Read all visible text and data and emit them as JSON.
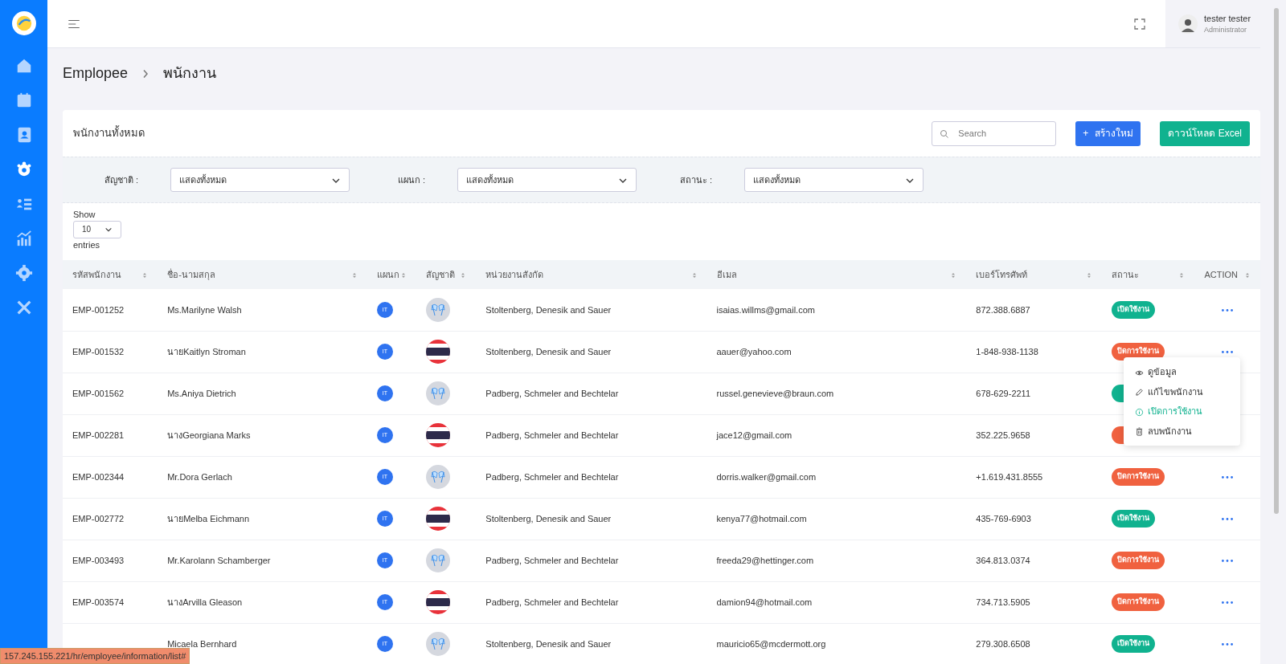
{
  "sidebar": {
    "items": [
      {
        "kind": "home",
        "selected": false
      },
      {
        "kind": "calendar",
        "selected": false
      },
      {
        "kind": "contacts",
        "selected": false
      },
      {
        "kind": "team",
        "selected": true
      },
      {
        "kind": "list",
        "selected": false
      },
      {
        "kind": "chart",
        "selected": false
      },
      {
        "kind": "gear",
        "selected": false
      },
      {
        "kind": "tools",
        "selected": false
      }
    ]
  },
  "user": {
    "name": "tester tester",
    "role": "Administrator"
  },
  "breadcrumb": [
    "Emplopee",
    "พนักงาน"
  ],
  "card": {
    "title": "พนักงานทั้งหมด",
    "search": {
      "placeholder": "Search"
    },
    "create_button": "สร้างใหม่",
    "create_icon": "+",
    "excel_button": "ดาวน์โหลด Excel"
  },
  "filters": [
    {
      "label": "สัญชาติ :",
      "value": "แสดงทั้งหมด"
    },
    {
      "label": "แผนก :",
      "value": "แสดงทั้งหมด"
    },
    {
      "label": "สถานะ :",
      "value": "แสดงทั้งหมด"
    }
  ],
  "page_size": {
    "before": "Show",
    "value": "10",
    "after": "entries"
  },
  "table": {
    "columns": [
      "รหัสพนักงาน",
      "ชื่อ-นามสกุล",
      "แผนก",
      "สัญชาติ",
      "หน่วยงานสังกัด",
      "อีเมล",
      "เบอร์โทรศัพท์",
      "สถานะ",
      "ACTION"
    ],
    "rows": [
      {
        "code": "EMP-001252",
        "name": "Ms.Marilyne Walsh",
        "dept": "IT",
        "nationality": {
          "kind": "generic"
        },
        "unit": "Stoltenberg, Denesik and Sauer",
        "email": "isaias.willms@gmail.com",
        "phone": "872.388.6887",
        "status": {
          "kind": "active",
          "label": "เปิดใช้งาน"
        }
      },
      {
        "code": "EMP-001532",
        "name": "นายKaitlyn Stroman",
        "dept": "IT",
        "nationality": {
          "kind": "thai"
        },
        "unit": "Stoltenberg, Denesik and Sauer",
        "email": "aauer@yahoo.com",
        "phone": "1-848-938-1138",
        "status": {
          "kind": "inactive",
          "label": "ปิดการใช้งาน"
        }
      },
      {
        "code": "EMP-001562",
        "name": "Ms.Aniya Dietrich",
        "dept": "IT",
        "nationality": {
          "kind": "generic"
        },
        "unit": "Padberg, Schmeler and Bechtelar",
        "email": "russel.genevieve@braun.com",
        "phone": "678-629-2211",
        "status": {
          "kind": "active"
        }
      },
      {
        "code": "EMP-002281",
        "name": "นางGeorgiana Marks",
        "dept": "IT",
        "nationality": {
          "kind": "thai"
        },
        "unit": "Padberg, Schmeler and Bechtelar",
        "email": "jace12@gmail.com",
        "phone": "352.225.9658",
        "status": {
          "kind": "inactive"
        }
      },
      {
        "code": "EMP-002344",
        "name": "Mr.Dora Gerlach",
        "dept": "IT",
        "nationality": {
          "kind": "generic"
        },
        "unit": "Padberg, Schmeler and Bechtelar",
        "email": "dorris.walker@gmail.com",
        "phone": "+1.619.431.8555",
        "status": {
          "kind": "inactive",
          "label": "ปิดการใช้งาน"
        }
      },
      {
        "code": "EMP-002772",
        "name": "นายMelba Eichmann",
        "dept": "IT",
        "nationality": {
          "kind": "thai"
        },
        "unit": "Stoltenberg, Denesik and Sauer",
        "email": "kenya77@hotmail.com",
        "phone": "435-769-6903",
        "status": {
          "kind": "active",
          "label": "เปิดใช้งาน"
        }
      },
      {
        "code": "EMP-003493",
        "name": "Mr.Karolann Schamberger",
        "dept": "IT",
        "nationality": {
          "kind": "generic"
        },
        "unit": "Padberg, Schmeler and Bechtelar",
        "email": "freeda29@hettinger.com",
        "phone": "364.813.0374",
        "status": {
          "kind": "inactive",
          "label": "ปิดการใช้งาน"
        }
      },
      {
        "code": "EMP-003574",
        "name": "นางArvilla Gleason",
        "dept": "IT",
        "nationality": {
          "kind": "thai"
        },
        "unit": "Padberg, Schmeler and Bechtelar",
        "email": "damion94@hotmail.com",
        "phone": "734.713.5905",
        "status": {
          "kind": "inactive",
          "label": "ปิดการใช้งาน"
        }
      },
      {
        "name": "Micaela Bernhard",
        "dept": "IT",
        "nationality": {
          "kind": "generic"
        },
        "unit": "Stoltenberg, Denesik and Sauer",
        "email": "mauricio65@mcdermott.org",
        "phone": "279.308.6508",
        "status": {
          "kind": "active",
          "label": "เปิดใช้งาน"
        }
      }
    ]
  },
  "action_menu": {
    "items": [
      {
        "kind": "view",
        "label": "ดูข้อมูล",
        "highlighted": false
      },
      {
        "kind": "edit",
        "label": "แก้ไขพนักงาน",
        "highlighted": false
      },
      {
        "kind": "enable",
        "label": "เปิดการใช้งาน",
        "highlighted": true
      },
      {
        "kind": "delete",
        "label": "ลบพนักงาน",
        "highlighted": false
      }
    ]
  },
  "link_preview": "157.245.155.221/hr/employee/information/list#"
}
